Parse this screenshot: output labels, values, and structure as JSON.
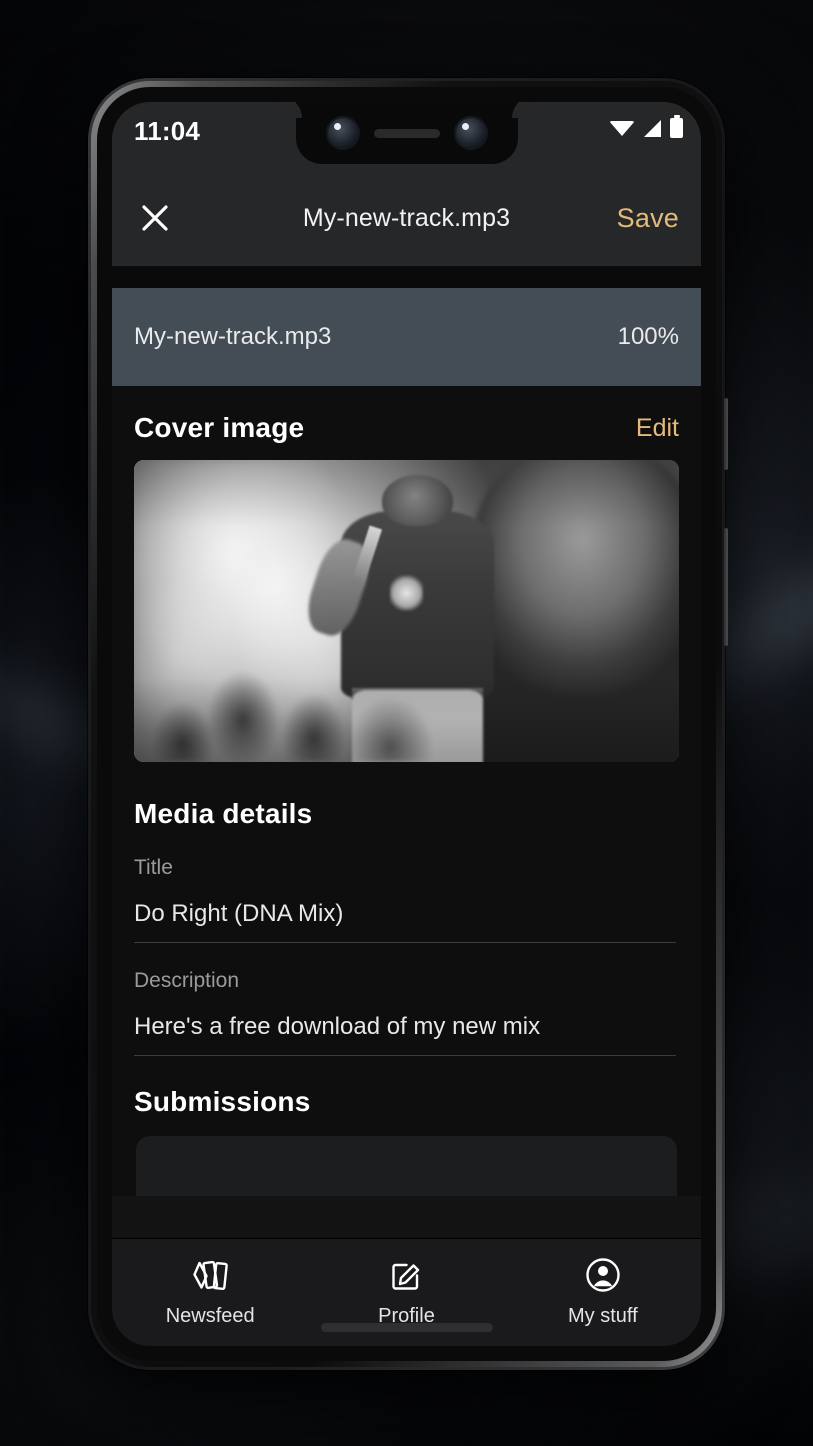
{
  "status_bar": {
    "clock": "11:04",
    "icons": [
      "wifi-icon",
      "cellular-signal-icon",
      "battery-icon"
    ]
  },
  "app_bar": {
    "close_icon": "close-icon",
    "title": "My-new-track.mp3",
    "save_label": "Save",
    "accent_color": "#e3ba79"
  },
  "upload": {
    "filename": "My-new-track.mp3",
    "percent_label": "100%",
    "percent_value": 100,
    "row_color": "#414a52"
  },
  "cover": {
    "section_title": "Cover image",
    "edit_label": "Edit",
    "image_alt": "grayscale photo of a performer singing into a microphone on stage with smoke and a crowd"
  },
  "media_details": {
    "heading": "Media details",
    "fields": [
      {
        "label": "Title",
        "value": "Do Right (DNA Mix)"
      },
      {
        "label": "Description",
        "value": "Here's a free download of my new mix"
      }
    ]
  },
  "submissions": {
    "heading": "Submissions"
  },
  "bottom_nav": {
    "items": [
      {
        "label": "Newsfeed",
        "icon": "cards-icon"
      },
      {
        "label": "Profile",
        "icon": "edit-square-icon"
      },
      {
        "label": "My stuff",
        "icon": "person-circle-icon"
      }
    ]
  }
}
